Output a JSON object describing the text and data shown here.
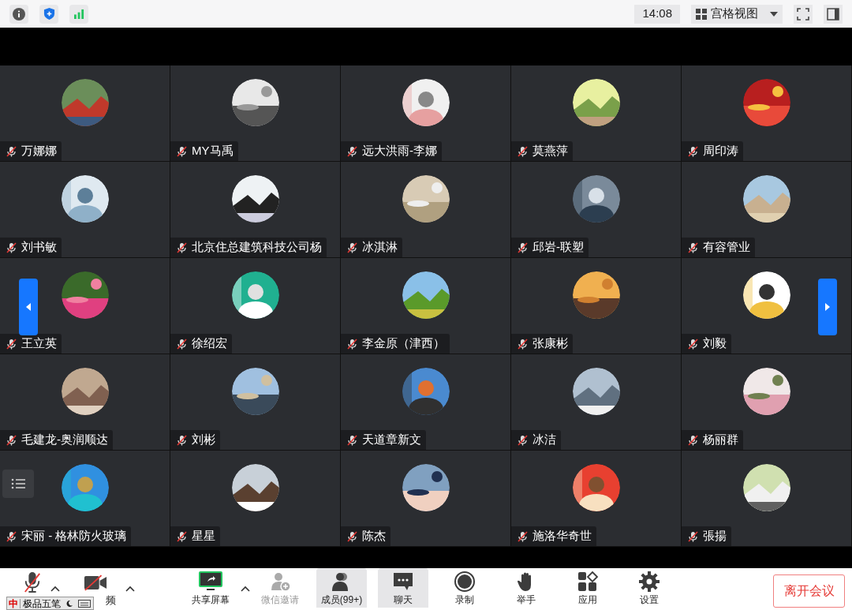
{
  "top_bar": {
    "time": "14:08",
    "view_menu": {
      "label": "宫格视图"
    }
  },
  "participants": [
    {
      "name": "万娜娜",
      "muted": true
    },
    {
      "name": "MY马禹",
      "muted": true
    },
    {
      "name": "远大洪雨-李娜",
      "muted": true
    },
    {
      "name": "莫燕萍",
      "muted": true
    },
    {
      "name": "周印涛",
      "muted": true
    },
    {
      "name": "刘书敏",
      "muted": true
    },
    {
      "name": "北京住总建筑科技公司杨",
      "muted": true
    },
    {
      "name": "冰淇淋",
      "muted": true
    },
    {
      "name": "邱岩-联塑",
      "muted": true
    },
    {
      "name": "有容管业",
      "muted": true
    },
    {
      "name": "王立英",
      "muted": true
    },
    {
      "name": "徐绍宏",
      "muted": true
    },
    {
      "name": "李金原（津西）",
      "muted": true
    },
    {
      "name": "张康彬",
      "muted": true
    },
    {
      "name": "刘毅",
      "muted": true
    },
    {
      "name": "毛建龙-奥润顺达",
      "muted": true
    },
    {
      "name": "刘彬",
      "muted": true
    },
    {
      "name": "天道章新文",
      "muted": true
    },
    {
      "name": "冰洁",
      "muted": true
    },
    {
      "name": "杨丽群",
      "muted": true
    },
    {
      "name": "宋丽 - 格林防火玻璃",
      "muted": true
    },
    {
      "name": "星星",
      "muted": true
    },
    {
      "name": "陈杰",
      "muted": true
    },
    {
      "name": "施洛华奇世",
      "muted": true
    },
    {
      "name": "張揚",
      "muted": true
    }
  ],
  "toolbar": {
    "mic": {
      "muted": true
    },
    "video": {
      "off": true,
      "label": "频"
    },
    "items": [
      {
        "kind": "share",
        "label": "共享屏幕",
        "disabled": false,
        "selected": false
      },
      {
        "kind": "invite",
        "label": "微信邀请",
        "disabled": true,
        "selected": false
      },
      {
        "kind": "members",
        "label": "成员(99+)",
        "disabled": false,
        "selected": true
      },
      {
        "kind": "chat",
        "label": "聊天",
        "disabled": false,
        "selected": true
      },
      {
        "kind": "record",
        "label": "录制",
        "disabled": false,
        "selected": false
      },
      {
        "kind": "hand",
        "label": "举手",
        "disabled": false,
        "selected": false
      },
      {
        "kind": "apps",
        "label": "应用",
        "disabled": false,
        "selected": false
      },
      {
        "kind": "settings",
        "label": "设置",
        "disabled": false,
        "selected": false
      }
    ],
    "leave_button": "离开会议"
  },
  "ime_bar": {
    "mode": "中",
    "name": "极品五笔"
  }
}
